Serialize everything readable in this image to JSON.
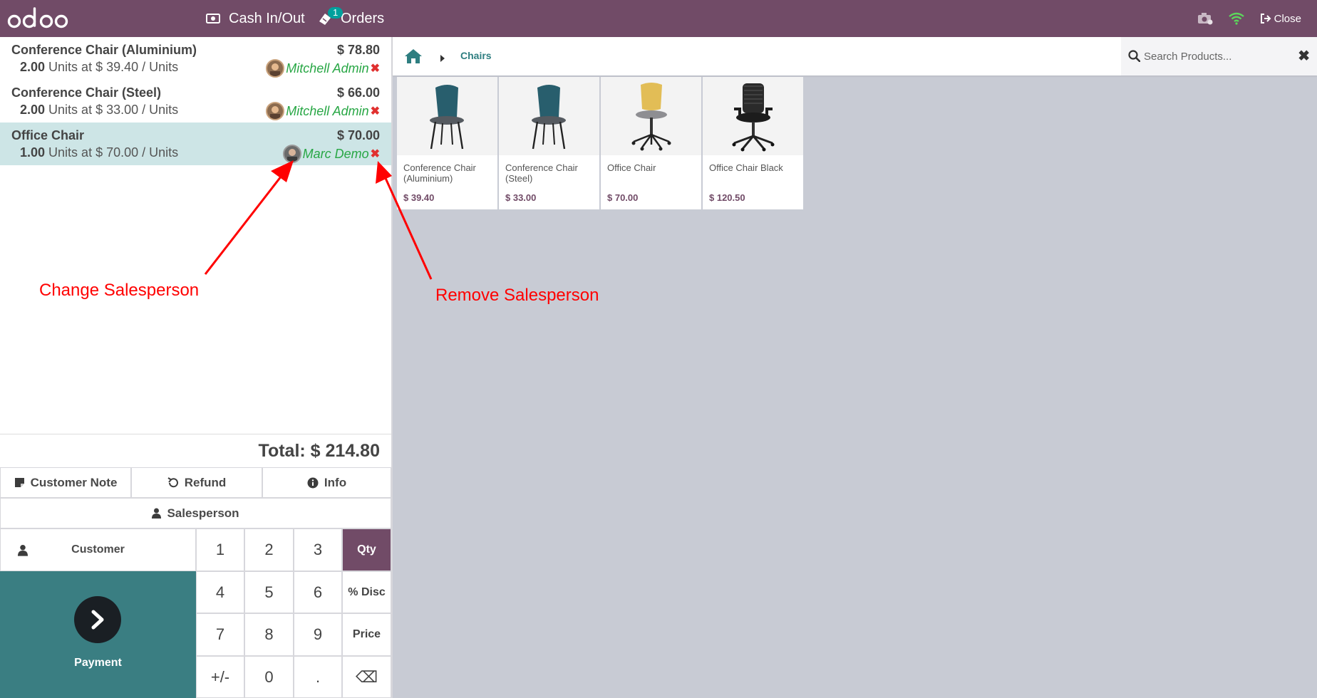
{
  "topbar": {
    "logo": "odoo",
    "cash_label": "Cash In/Out",
    "orders_label": "Orders",
    "orders_badge": "1",
    "close_label": "Close",
    "icons": [
      "camera-icon",
      "wifi-icon",
      "sign-out-icon"
    ]
  },
  "orderlines": [
    {
      "name": "Conference Chair (Aluminium)",
      "price": "$ 78.80",
      "qty": "2.00",
      "qty_rest": " Units at $ 39.40 / Units",
      "salesperson": "Mitchell Admin",
      "remove": "✖",
      "selected": false
    },
    {
      "name": "Conference Chair (Steel)",
      "price": "$ 66.00",
      "qty": "2.00",
      "qty_rest": " Units at $ 33.00 / Units",
      "salesperson": "Mitchell Admin",
      "remove": "✖",
      "selected": false
    },
    {
      "name": "Office Chair",
      "price": "$ 70.00",
      "qty": "1.00",
      "qty_rest": " Units at $ 70.00 / Units",
      "salesperson": "Marc Demo",
      "remove": "✖",
      "selected": true
    }
  ],
  "annotations": {
    "change": "Change Salesperson",
    "remove": "Remove Salesperson",
    "color": "#ff0000"
  },
  "total": "Total: $ 214.80",
  "controls": {
    "customer_note": "Customer Note",
    "refund": "Refund",
    "info": "Info",
    "salesperson": "Salesperson",
    "customer": "Customer",
    "payment": "Payment"
  },
  "numpad": {
    "k1": "1",
    "k2": "2",
    "k3": "3",
    "qty": "Qty",
    "k4": "4",
    "k5": "5",
    "k6": "6",
    "disc": "% Disc",
    "k7": "7",
    "k8": "8",
    "k9": "9",
    "price": "Price",
    "pm": "+/-",
    "k0": "0",
    "dot": ".",
    "backspace": "⌫",
    "active_mode": "Qty"
  },
  "breadcrumb": {
    "category": "Chairs"
  },
  "search": {
    "placeholder": "Search Products...",
    "clear": "✖"
  },
  "products": [
    {
      "name": "Conference Chair (Aluminium)",
      "price": "$ 39.40",
      "image": "teal-chair"
    },
    {
      "name": "Conference Chair (Steel)",
      "price": "$ 33.00",
      "image": "teal-chair"
    },
    {
      "name": "Office Chair",
      "price": "$ 70.00",
      "image": "yellow-office-chair"
    },
    {
      "name": "Office Chair Black",
      "price": "$ 120.50",
      "image": "black-office-chair"
    }
  ],
  "colors": {
    "brand": "#714b67",
    "teal": "#3a7e82",
    "selected_line": "#cde5e6",
    "salesperson": "#28a745",
    "remove": "#e0302f"
  }
}
